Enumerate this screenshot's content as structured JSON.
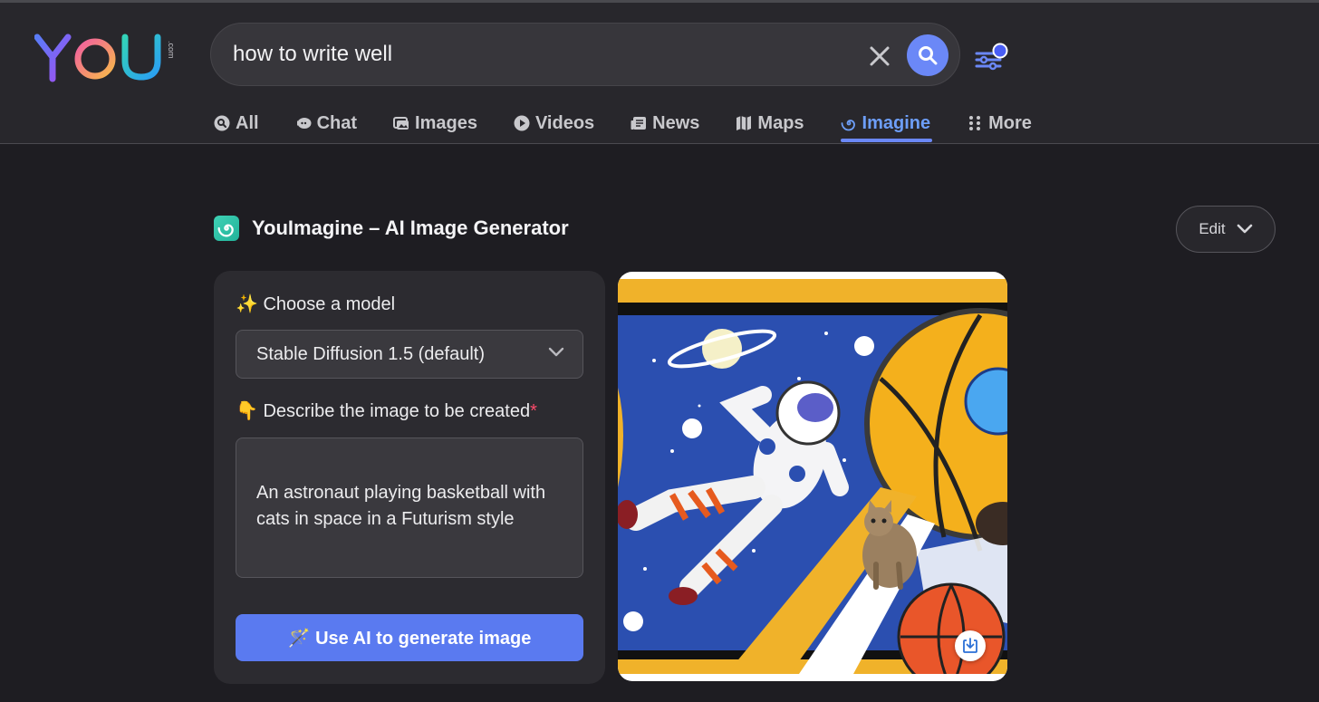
{
  "logo": {
    "text": "YOU",
    "suffix": ".com"
  },
  "search": {
    "query": "how to write well"
  },
  "tabs": [
    {
      "label": "All",
      "icon": "search-circle-icon"
    },
    {
      "label": "Chat",
      "icon": "chat-icon"
    },
    {
      "label": "Images",
      "icon": "images-icon"
    },
    {
      "label": "Videos",
      "icon": "play-icon"
    },
    {
      "label": "News",
      "icon": "news-icon"
    },
    {
      "label": "Maps",
      "icon": "map-icon"
    },
    {
      "label": "Imagine",
      "icon": "spiral-icon",
      "active": true
    },
    {
      "label": "More",
      "icon": "grid-dots-icon"
    }
  ],
  "section": {
    "title": "YouImagine – AI Image Generator",
    "edit_label": "Edit"
  },
  "form": {
    "model_label": "✨ Choose a model",
    "model_value": "Stable Diffusion 1.5 (default)",
    "describe_label": "👇 Describe the image to be created",
    "required_mark": "*",
    "prompt": "An astronaut playing basketball with cats in space in a Futurism style",
    "generate_label": "🪄 Use AI to generate image"
  },
  "colors": {
    "accent": "#6b88f7",
    "active_tab": "#6d9ef8",
    "generate_button": "#5a7af0",
    "background": "#1e1d22"
  }
}
